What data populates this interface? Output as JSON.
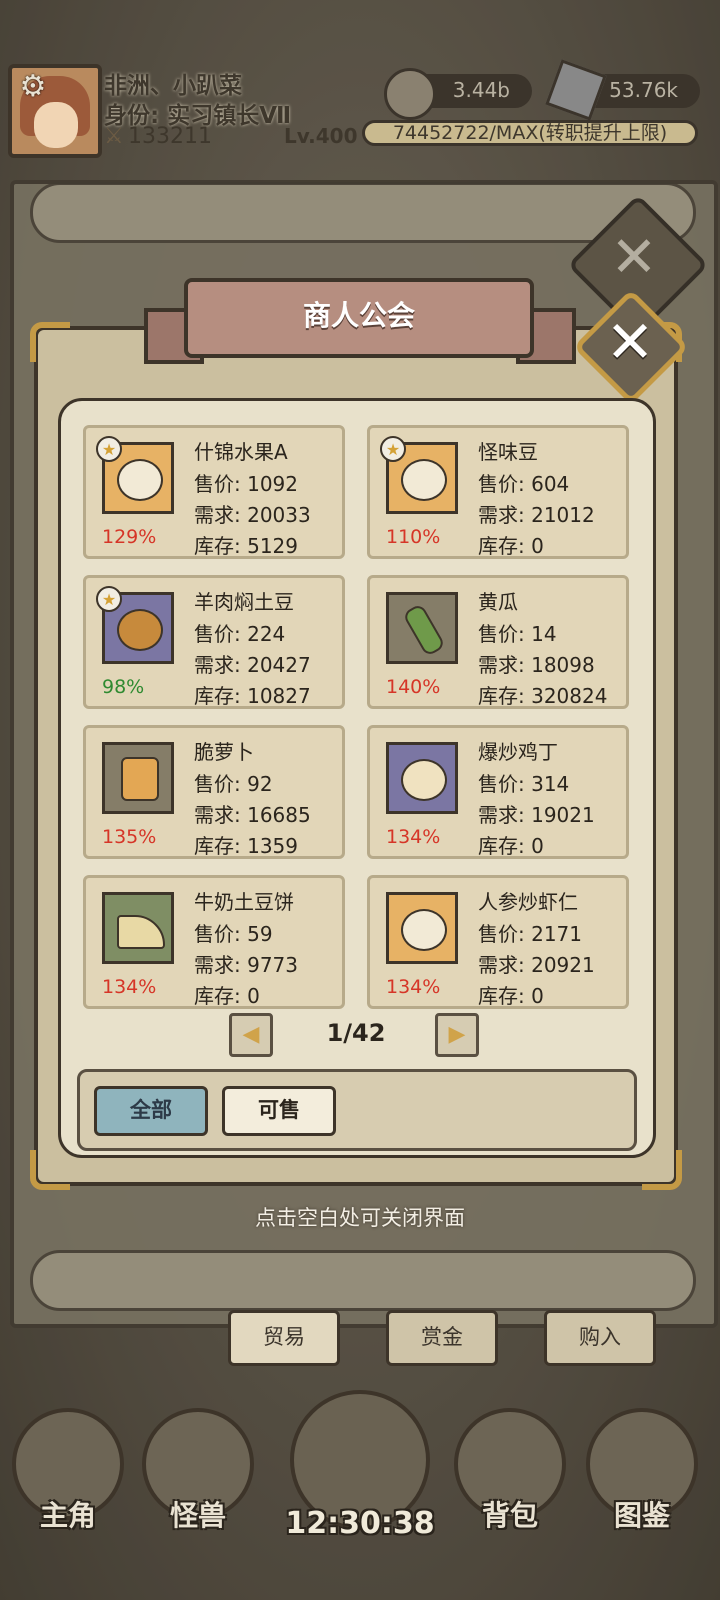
{
  "header": {
    "player_name": "非洲、小趴菜",
    "player_title": "身份: 实习镇长Ⅶ",
    "power": "133211",
    "level": "Lv.400",
    "coins": "3.44b",
    "gems": "53.76k",
    "exp": "74452722/MAX(转职提升上限)"
  },
  "panel": {
    "title": "商人公会",
    "items": [
      {
        "name": "什锦水果A",
        "price": "售价: 1092",
        "demand": "需求: 20033",
        "stock": "库存: 5129",
        "percent": "129%",
        "starred": true
      },
      {
        "name": "怪味豆",
        "price": "售价: 604",
        "demand": "需求: 21012",
        "stock": "库存: 0",
        "percent": "110%",
        "starred": true
      },
      {
        "name": "羊肉焖土豆",
        "price": "售价: 224",
        "demand": "需求: 20427",
        "stock": "库存: 10827",
        "percent": "98%",
        "starred": true
      },
      {
        "name": "黄瓜",
        "price": "售价: 14",
        "demand": "需求: 18098",
        "stock": "库存: 320824",
        "percent": "140%",
        "starred": false
      },
      {
        "name": "脆萝卜",
        "price": "售价: 92",
        "demand": "需求: 16685",
        "stock": "库存: 1359",
        "percent": "135%",
        "starred": false
      },
      {
        "name": "爆炒鸡丁",
        "price": "售价: 314",
        "demand": "需求: 19021",
        "stock": "库存: 0",
        "percent": "134%",
        "starred": false
      },
      {
        "name": "牛奶土豆饼",
        "price": "售价: 59",
        "demand": "需求: 9773",
        "stock": "库存: 0",
        "percent": "134%",
        "starred": false
      },
      {
        "name": "人参炒虾仁",
        "price": "售价: 2171",
        "demand": "需求: 20921",
        "stock": "库存: 0",
        "percent": "134%",
        "starred": false
      }
    ],
    "page": "1/42",
    "filters": {
      "all": "全部",
      "sellable": "可售"
    }
  },
  "hint": "点击空白处可关闭界面",
  "tabs": {
    "trade": "贸易",
    "bounty": "赏金",
    "buy": "购入"
  },
  "nav": {
    "hero": "主角",
    "monster": "怪兽",
    "bag": "背包",
    "codex": "图鉴",
    "clock": "12:30:38"
  },
  "colors": {
    "percent_high": "#d63527",
    "percent_low": "#2f8a30",
    "active_filter": "#8fb4bd",
    "gold_trim": "#c49a45"
  }
}
